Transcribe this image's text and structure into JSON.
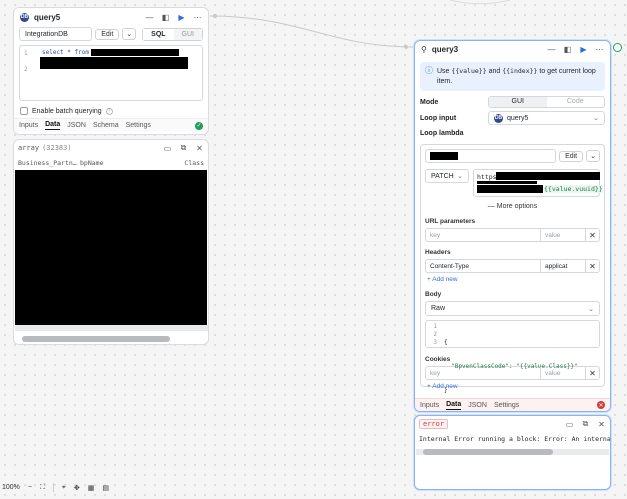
{
  "query5": {
    "title": "query5",
    "db_icon": "DB",
    "resource": "IntegrationDB",
    "edit": "Edit",
    "mode_sql": "SQL",
    "mode_gui": "GUI",
    "code_lines": [
      "1",
      "2"
    ],
    "code_prefix": "select * from",
    "batch_label": "Enable batch querying",
    "tabs": [
      "Inputs",
      "Data",
      "JSON",
      "Schema",
      "Settings"
    ],
    "active_tab": "Data",
    "status_color": "#1e9e5a"
  },
  "result5": {
    "type_label": "array",
    "count": "(32383)",
    "columns": [
      "Business_Partn…",
      "bpName",
      "Class"
    ]
  },
  "query3": {
    "title": "query3",
    "info_text_before": "Use ",
    "info_token1": "{{value}}",
    "info_and": " and ",
    "info_token2": "{{index}}",
    "info_text_after": " to get current loop item.",
    "mode_label": "Mode",
    "mode_gui": "GUI",
    "mode_code": "Code",
    "loop_input_label": "Loop input",
    "loop_input_value": "query5",
    "loop_lambda_label": "Loop lambda",
    "edit": "Edit",
    "method": "PATCH",
    "url_prefix": "https:",
    "url_suffix": "{{value.vuuid}}",
    "more_options": "More options",
    "url_params_label": "URL parameters",
    "key_placeholder": "key",
    "value_placeholder": "value",
    "headers_label": "Headers",
    "header_key": "Content-Type",
    "header_value": "applicat",
    "add_new": "Add new",
    "body_label": "Body",
    "body_type": "Raw",
    "body_lines": [
      "1",
      "2",
      "3"
    ],
    "body_code": [
      "{",
      "  \"BpvenClassCode\": \"{{value.Class}}\"",
      "}"
    ],
    "cookies_label": "Cookies",
    "tabs": [
      "Inputs",
      "Data",
      "JSON",
      "Settings"
    ],
    "active_tab": "Data",
    "status_color": "#d43a3a"
  },
  "error_panel": {
    "label": "error",
    "message": "Internal Error running a block: Error: An internal server"
  },
  "zoom": {
    "level": "100%"
  },
  "colors": {
    "accent": "#2f6fdb",
    "success": "#1e9e5a",
    "error": "#d43a3a",
    "info_bg": "#e8f1fd"
  }
}
